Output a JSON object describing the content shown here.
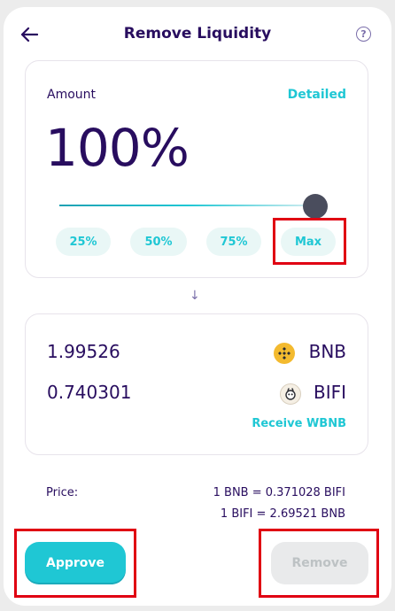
{
  "header": {
    "title": "Remove Liquidity",
    "back_icon": "arrow-left-icon",
    "help_glyph": "?"
  },
  "amount": {
    "label": "Amount",
    "detailed_link": "Detailed",
    "value": "100%",
    "slider_percent": 100,
    "buttons": [
      "25%",
      "50%",
      "75%",
      "Max"
    ]
  },
  "arrow": "↓",
  "receive": {
    "tokens": [
      {
        "amount": "1.99526",
        "symbol": "BNB",
        "icon": "bnb-icon",
        "icon_color": "#f3ba2f"
      },
      {
        "amount": "0.740301",
        "symbol": "BIFI",
        "icon": "bifi-icon",
        "icon_color": "#f5efe4"
      }
    ],
    "receive_link": "Receive WBNB"
  },
  "price": {
    "label": "Price:",
    "lines": [
      "1 BNB = 0.371028 BIFI",
      "1 BIFI = 2.69521 BNB"
    ]
  },
  "actions": {
    "approve_label": "Approve",
    "remove_label": "Remove"
  },
  "colors": {
    "accent": "#1fc7d4",
    "text": "#280d5f",
    "highlight": "#e00012",
    "disabled_bg": "#e9eaeb"
  }
}
